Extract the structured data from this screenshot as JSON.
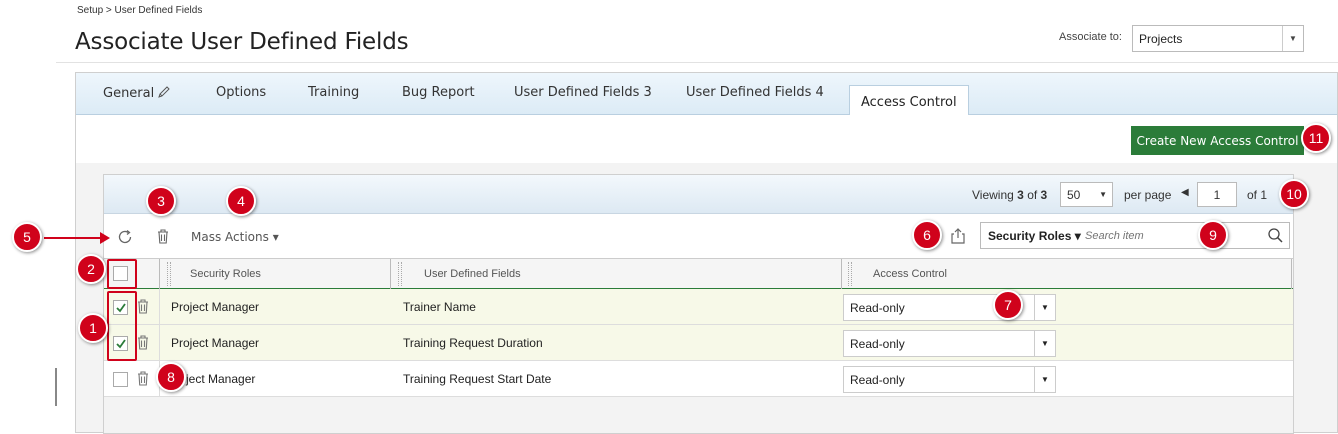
{
  "breadcrumb": "Setup > User Defined Fields",
  "page_title": "Associate User Defined Fields",
  "associate": {
    "label": "Associate to:",
    "value": "Projects"
  },
  "tabs": [
    {
      "label": "General",
      "has_edit_icon": true
    },
    {
      "label": "Options"
    },
    {
      "label": "Training"
    },
    {
      "label": "Bug Report"
    },
    {
      "label": "User Defined Fields 3"
    },
    {
      "label": "User Defined Fields 4"
    },
    {
      "label": "Access Control",
      "active": true
    }
  ],
  "create_button": "Create New Access Control",
  "pager": {
    "viewing_prefix": "Viewing",
    "viewing_count": "3",
    "viewing_of": "of",
    "viewing_total": "3",
    "per_page_value": "50",
    "per_page_label": "per page",
    "page_value": "1",
    "of_label": "of 1"
  },
  "toolbar": {
    "mass_actions": "Mass Actions",
    "search_field": "Security Roles",
    "search_placeholder": "Search item"
  },
  "columns": [
    "Security Roles",
    "User Defined Fields",
    "Access Control"
  ],
  "rows": [
    {
      "role": "Project Manager",
      "field": "Trainer Name",
      "access": "Read-only",
      "checked": true
    },
    {
      "role": "Project Manager",
      "field": "Training Request Duration",
      "access": "Read-only",
      "checked": true
    },
    {
      "role": "ject Manager",
      "field": "Training Request Start Date",
      "access": "Read-only",
      "checked": false
    }
  ],
  "callouts": [
    "1",
    "2",
    "3",
    "4",
    "5",
    "6",
    "7",
    "8",
    "9",
    "10",
    "11"
  ],
  "colors": {
    "accent_green": "#2b7c39",
    "callout_red": "#d0021b",
    "tab_blue": "#dcebf6"
  }
}
